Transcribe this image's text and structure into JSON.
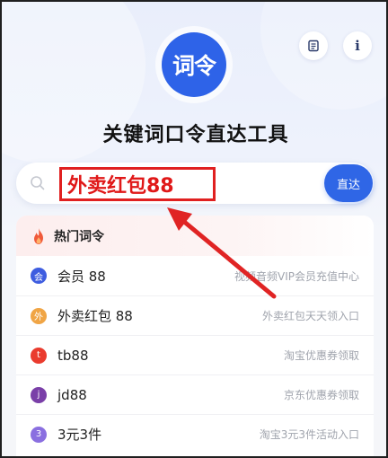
{
  "header": {
    "logo_text": "词令",
    "title": "关键词口令直达工具"
  },
  "search": {
    "value": "外卖红包88",
    "button_label": "直达"
  },
  "hot": {
    "title": "热门词令",
    "items": [
      {
        "badge": "会",
        "name": "会员 88",
        "desc": "视频音频VIP会员充值中心",
        "color": "#3e5de0"
      },
      {
        "badge": "外",
        "name": "外卖红包 88",
        "desc": "外卖红包天天领入口",
        "color": "#f0a545"
      },
      {
        "badge": "t",
        "name": "tb88",
        "desc": "淘宝优惠券领取",
        "color": "#ea3b2e"
      },
      {
        "badge": "j",
        "name": "jd88",
        "desc": "京东优惠券领取",
        "color": "#7a3fa8"
      },
      {
        "badge": "3",
        "name": "3元3件",
        "desc": "淘宝3元3件活动入口",
        "color": "#8a6fe0"
      }
    ]
  },
  "colors": {
    "accent": "#2f66e6",
    "highlight": "#e02020"
  },
  "icons": {
    "doc_button": "document-icon",
    "info_button": "info-icon",
    "search": "search-icon",
    "hot": "flame-icon"
  }
}
